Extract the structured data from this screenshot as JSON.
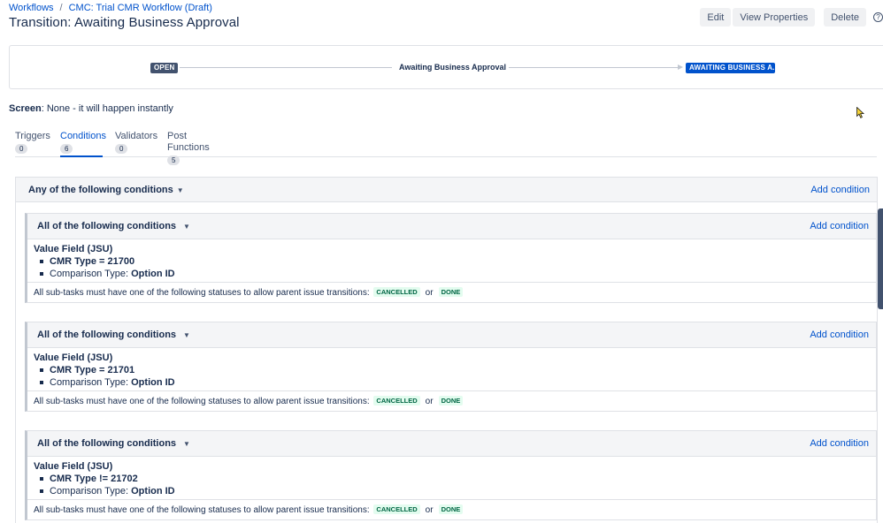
{
  "breadcrumb": {
    "root": "Workflows",
    "separator": "/",
    "current": "CMC: Trial CMR Workflow (Draft)"
  },
  "page_title": "Transition: Awaiting Business Approval",
  "actions": {
    "edit": "Edit",
    "view_properties": "View Properties",
    "delete": "Delete",
    "help": "?"
  },
  "diagram": {
    "from": "OPEN",
    "transition": "Awaiting Business Approval",
    "to": "AWAITING BUSINESS A..."
  },
  "screen": {
    "label": "Screen",
    "value": ": None - it will happen instantly"
  },
  "tabs": [
    {
      "label": "Triggers",
      "count": "0"
    },
    {
      "label": "Conditions",
      "count": "6"
    },
    {
      "label": "Validators",
      "count": "0"
    },
    {
      "label": "Post Functions",
      "count": "5"
    }
  ],
  "outer_group": {
    "title": "Any of the following conditions",
    "add": "Add condition"
  },
  "groups": [
    {
      "title": "All of the following conditions",
      "add": "Add condition",
      "vf_title": "Value Field (JSU)",
      "item1": "CMR Type = 21700",
      "item2_label": "Comparison Type: ",
      "item2_value": "Option ID",
      "foot": "All sub-tasks must have one of the following statuses to allow parent issue transitions:",
      "status1": "CANCELLED",
      "or": "or",
      "status2": "DONE"
    },
    {
      "title": "All of the following conditions",
      "add": "Add condition",
      "vf_title": "Value Field (JSU)",
      "item1": "CMR Type = 21701",
      "item2_label": "Comparison Type: ",
      "item2_value": "Option ID",
      "foot": "All sub-tasks must have one of the following statuses to allow parent issue transitions:",
      "status1": "CANCELLED",
      "or": "or",
      "status2": "DONE"
    },
    {
      "title": "All of the following conditions",
      "add": "Add condition",
      "vf_title": "Value Field (JSU)",
      "item1": "CMR Type != 21702",
      "item2_label": "Comparison Type: ",
      "item2_value": "Option ID",
      "foot": "All sub-tasks must have one of the following statuses to allow parent issue transitions:",
      "status1": "CANCELLED",
      "or": "or",
      "status2": "DONE"
    }
  ],
  "colors": {
    "link": "#0052cc",
    "text": "#172b4d",
    "status_bg": "#e3fcef",
    "status_fg": "#006644"
  },
  "icons": {
    "chevron": "chevron-down-icon",
    "help": "help-icon"
  }
}
